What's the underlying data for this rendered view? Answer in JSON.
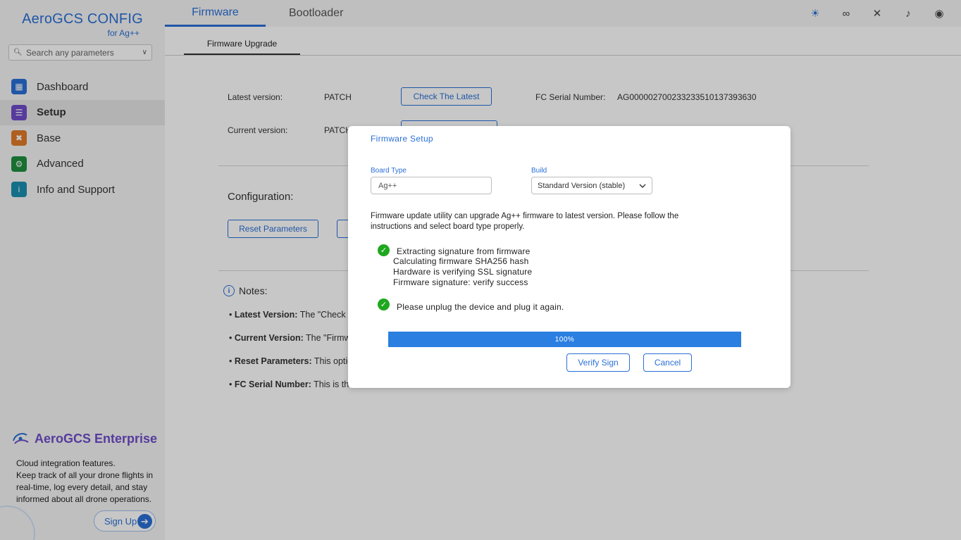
{
  "sidebar": {
    "brand_title": "AeroGCS CONFIG",
    "brand_sub": "for Ag++",
    "search_placeholder": "Search any parameters",
    "items": [
      {
        "label": "Dashboard",
        "color": "#2a6fd6"
      },
      {
        "label": "Setup",
        "color": "#6f4cc9"
      },
      {
        "label": "Base",
        "color": "#e07a2a"
      },
      {
        "label": "Advanced",
        "color": "#1e8f3e"
      },
      {
        "label": "Info and Support",
        "color": "#1a8fb0"
      }
    ],
    "promo": {
      "title": "AeroGCS Enterprise",
      "line1": "Cloud integration features.",
      "line2": "Keep track of all your drone flights in real-time, log every detail, and stay informed about all drone operations.",
      "signup": "Sign Up"
    }
  },
  "tabs": {
    "firmware": "Firmware",
    "bootloader": "Bootloader"
  },
  "subtab": "Firmware Upgrade",
  "main": {
    "latest_label": "Latest version:",
    "latest_value": "PATCH",
    "check_latest": "Check The Latest",
    "serial_label": "FC Serial Number:",
    "serial_value": "AG000002700233233510137393630",
    "current_label": "Current version:",
    "current_value": "PATCH",
    "config_title": "Configuration:",
    "reset_params": "Reset Parameters",
    "notes_title": "Notes:",
    "notes": [
      {
        "bold": "Latest Version:",
        "text": " The \"Check t"
      },
      {
        "bold": "Current Version:",
        "text": " The \"Firmw"
      },
      {
        "bold": "Reset Parameters:",
        "text": " This optio"
      },
      {
        "bold": "FC Serial Number:",
        "text": " This is the"
      }
    ]
  },
  "modal": {
    "title": "Firmware Setup",
    "board_label": "Board Type",
    "board_value": "Ag++",
    "build_label": "Build",
    "build_value": "Standard Version (stable)",
    "description": "Firmware update utility can upgrade Ag++ firmware to latest version. Please follow the instructions and select board type properly.",
    "steps": [
      "Extracting signature from firmware",
      "Calculating firmware SHA256 hash",
      "Hardware is verifying SSL signature",
      "Firmware signature: verify success"
    ],
    "replug": "Please unplug the device and plug it again.",
    "progress_label": "100%",
    "progress_value": 1.0,
    "verify_sign": "Verify Sign",
    "cancel": "Cancel"
  }
}
